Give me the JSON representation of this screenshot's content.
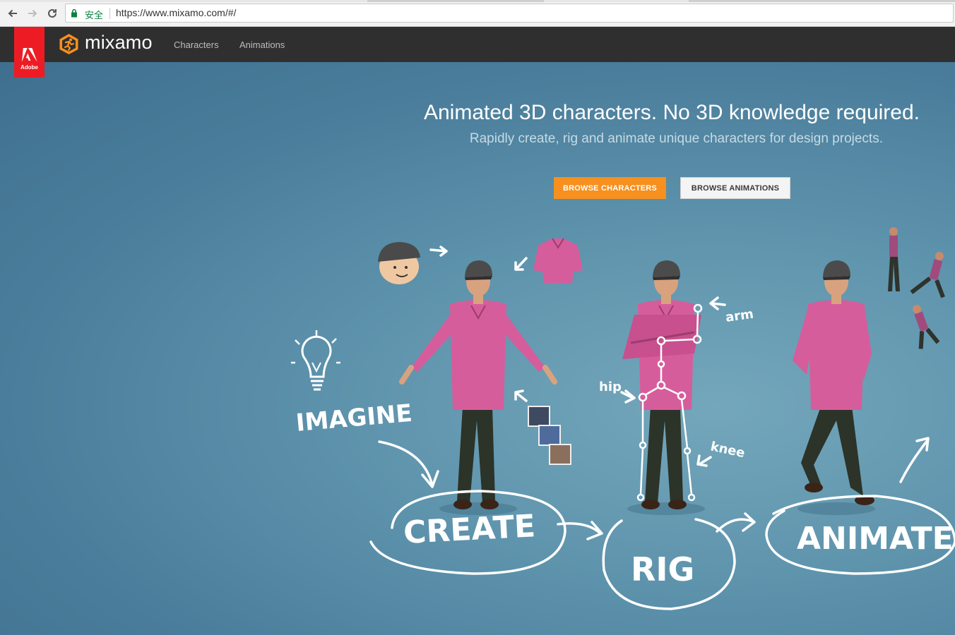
{
  "browser": {
    "secure_label": "安全",
    "url": "https://www.mixamo.com/#/"
  },
  "header": {
    "adobe_label": "Adobe",
    "brand": "mixamo",
    "nav": [
      "Characters",
      "Animations"
    ]
  },
  "hero": {
    "headline": "Animated 3D characters. No 3D knowledge required.",
    "subline": "Rapidly create, rig and animate unique characters for design projects.",
    "primary_button": "BROWSE CHARACTERS",
    "secondary_button": "BROWSE ANIMATIONS"
  },
  "illustration": {
    "words": [
      "IMAGINE",
      "CREATE",
      "RIG",
      "ANIMATE"
    ],
    "labels": [
      "arm",
      "hip",
      "knee"
    ]
  },
  "colors": {
    "accent": "#f7901e",
    "header_bg": "#2f2f2f",
    "adobe_red": "#ed1c24",
    "shirt": "#d65d9c"
  }
}
